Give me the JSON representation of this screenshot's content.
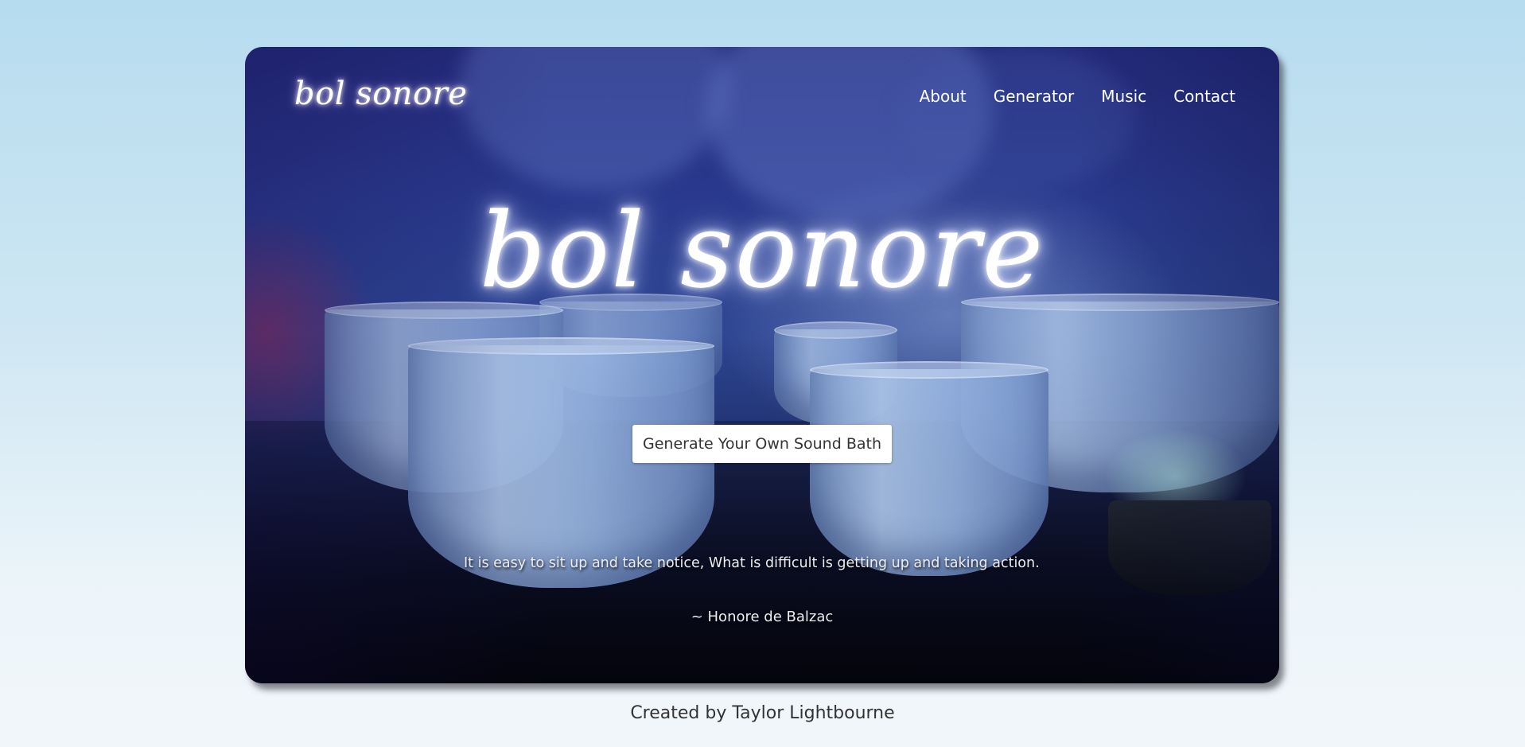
{
  "nav": {
    "logo": "bol sonore",
    "links": [
      "About",
      "Generator",
      "Music",
      "Contact"
    ]
  },
  "hero": {
    "title": "bol sonore",
    "cta_label": "Generate Your Own Sound Bath",
    "quote": "It is easy to sit up and take notice, What is difficult is getting up and taking action.",
    "quote_author": "~ Honore de Balzac"
  },
  "footer": {
    "credit": "Created by Taylor Lightbourne"
  },
  "colors": {
    "page_background_top": "#b6dcef",
    "page_background_bottom": "#f1f6fa",
    "hero_overlay": "#232a7a",
    "button_background": "#ffffff",
    "footer_text": "#333333"
  }
}
